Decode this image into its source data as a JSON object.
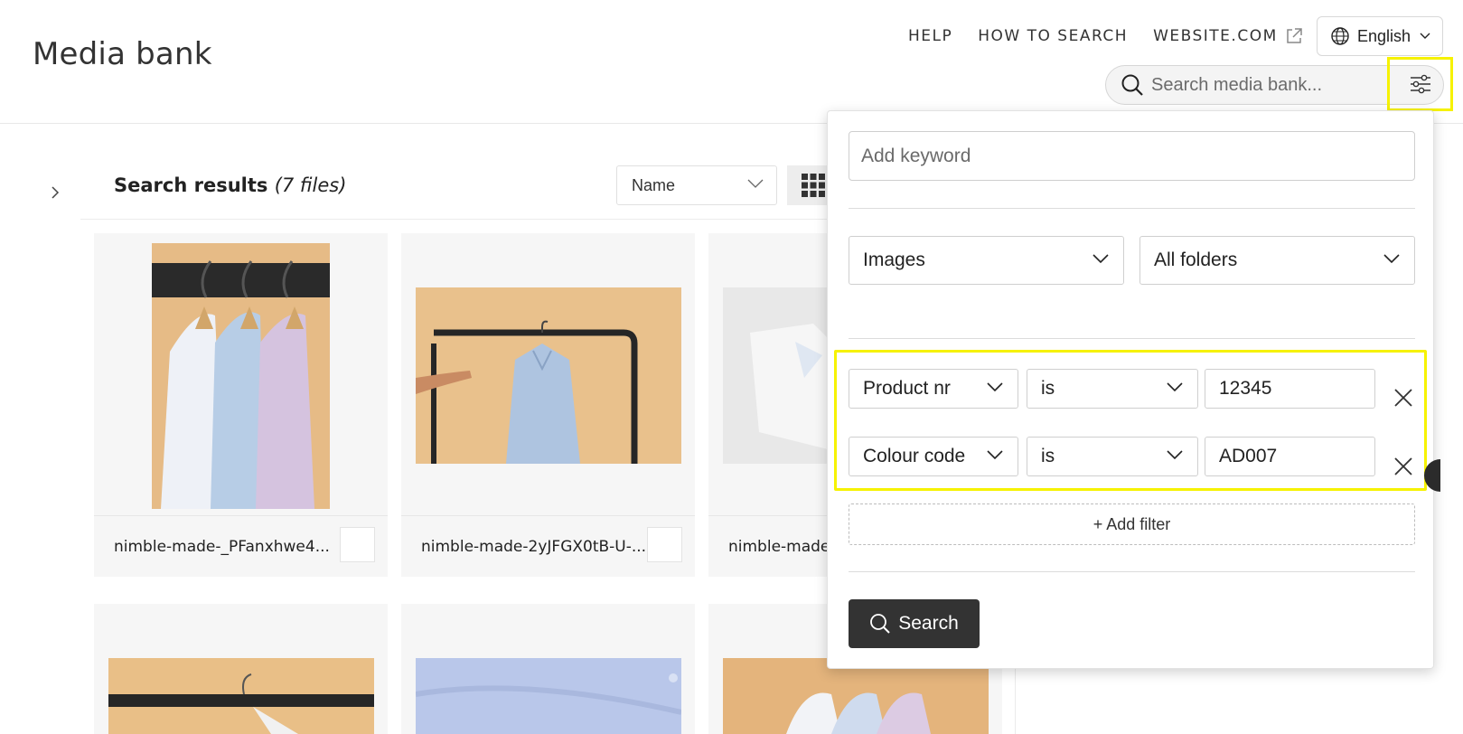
{
  "header": {
    "title": "Media bank",
    "nav": [
      {
        "label": "HELP"
      },
      {
        "label": "HOW TO SEARCH"
      },
      {
        "label": "WEBSITE.COM"
      }
    ],
    "language": "English",
    "search_placeholder": "Search media bank..."
  },
  "results": {
    "title": "Search results",
    "count": "(7 files)",
    "sort_value": "Name"
  },
  "cards": [
    {
      "filename": "nimble-made-_PFanxhwe4..."
    },
    {
      "filename": "nimble-made-2yJFGX0tB-U-..."
    },
    {
      "filename": "nimble-made"
    }
  ],
  "filter_panel": {
    "keyword_placeholder": "Add keyword",
    "type_select": "Images",
    "folder_select": "All folders",
    "rules": [
      {
        "field": "Product nr",
        "operator": "is",
        "value": "12345"
      },
      {
        "field": "Colour code",
        "operator": "is",
        "value": "AD007"
      }
    ],
    "add_filter_label": "+ Add filter",
    "search_label": "Search"
  },
  "colors": {
    "highlight": "#f6f200",
    "button_dark": "#333333",
    "shirt_bg": "#e9c18c"
  }
}
